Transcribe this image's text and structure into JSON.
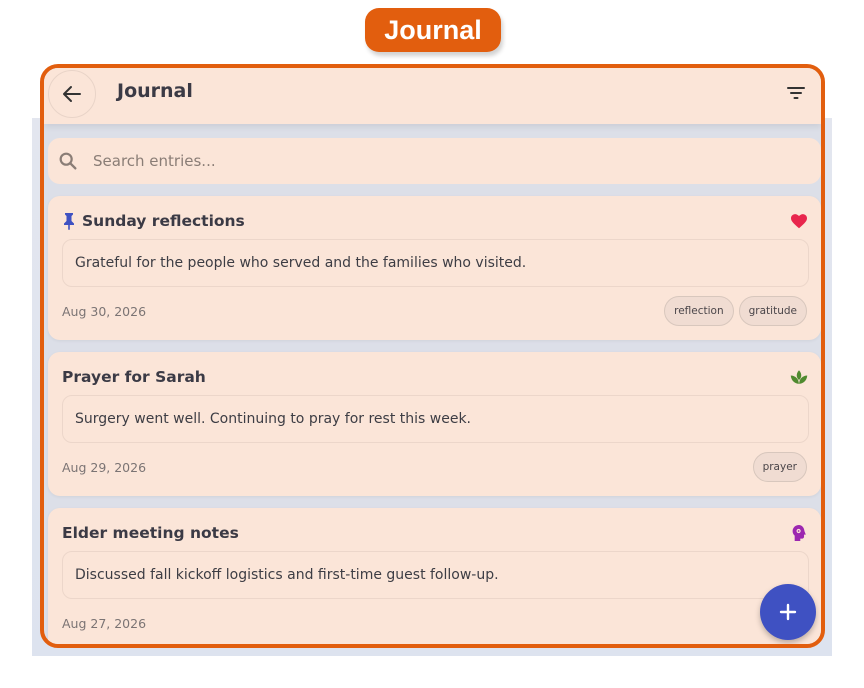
{
  "header_badge": "Journal",
  "appbar": {
    "title": "Journal",
    "back_icon": "arrow-left-icon",
    "filter_icon": "filter-icon"
  },
  "search": {
    "placeholder": "Search entries...",
    "value": "",
    "icon": "search-icon"
  },
  "entries": [
    {
      "title": "Sunday reflections",
      "pinned": true,
      "mood_icon": "heart-icon",
      "mood_color": "#e8264d",
      "body": "Grateful for the people who served and the families who visited.",
      "date": "Aug 30, 2026",
      "tags": [
        "reflection",
        "gratitude"
      ]
    },
    {
      "title": "Prayer for Sarah",
      "pinned": false,
      "mood_icon": "spa-icon",
      "mood_color": "#4f8a2f",
      "body": "Surgery went well. Continuing to pray for rest this week.",
      "date": "Aug 29, 2026",
      "tags": [
        "prayer"
      ]
    },
    {
      "title": "Elder meeting notes",
      "pinned": false,
      "mood_icon": "psychology-icon",
      "mood_color": "#9c27b0",
      "body": "Discussed fall kickoff logistics and first-time guest follow-up.",
      "date": "Aug 27, 2026",
      "tags": []
    }
  ],
  "fab": {
    "icon": "plus-icon",
    "label": "+"
  },
  "colors": {
    "accent": "#e25e0e",
    "card": "#fbe5d8",
    "fab": "#3f51c2",
    "pin": "#3f51c2"
  }
}
